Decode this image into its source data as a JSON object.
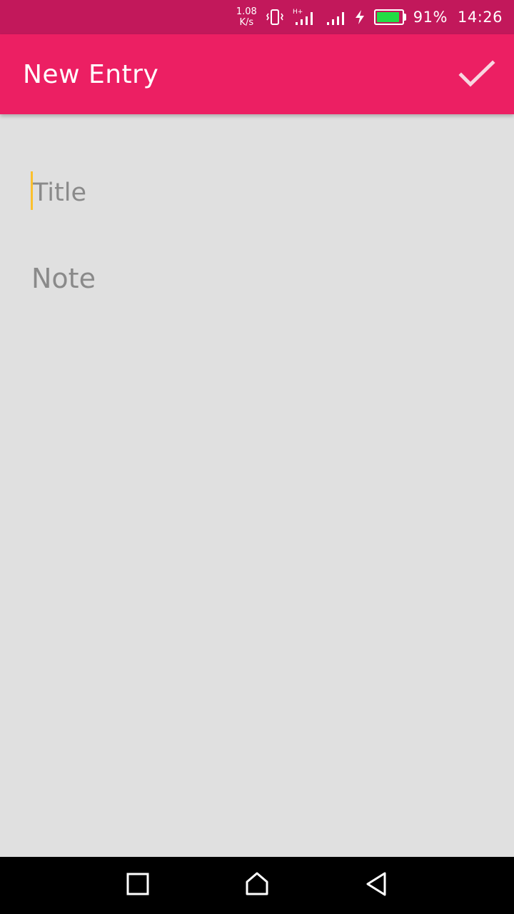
{
  "status_bar": {
    "speed_value": "1.08",
    "speed_unit": "K/s",
    "network_type": "H+",
    "battery_percent": "91%",
    "battery_level": 0.91,
    "time": "14:26",
    "battery_color": "#22dd44"
  },
  "app_bar": {
    "title": "New Entry",
    "confirm_icon": "check-icon",
    "color": "#ec1f63"
  },
  "form": {
    "title_placeholder": "Title",
    "title_value": "",
    "note_placeholder": "Note",
    "note_value": "",
    "cursor_color": "#fbc02d"
  },
  "nav_bar": {
    "recents_icon": "square-icon",
    "home_icon": "home-icon",
    "back_icon": "triangle-back-icon"
  }
}
